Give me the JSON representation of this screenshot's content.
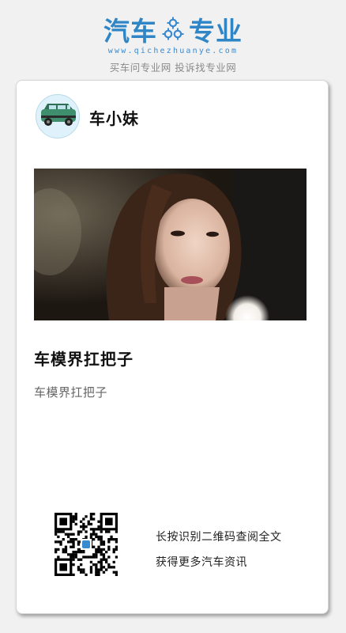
{
  "header": {
    "brand_left": "汽车",
    "brand_right": "专业",
    "brand_url": "www.qichezhuanye.com",
    "slogan": "买车问专业网 投诉找专业网",
    "brand_color": "#2f86c7"
  },
  "card": {
    "author_name": "车小妹",
    "article_title": "车模界扛把子",
    "article_summary": "车模界扛把子",
    "qr": {
      "line1": "长按识别二维码查阅全文",
      "line2": "获得更多汽车资讯"
    }
  },
  "icons": {
    "logo_gear": "gear-icon",
    "avatar": "car-icon"
  }
}
